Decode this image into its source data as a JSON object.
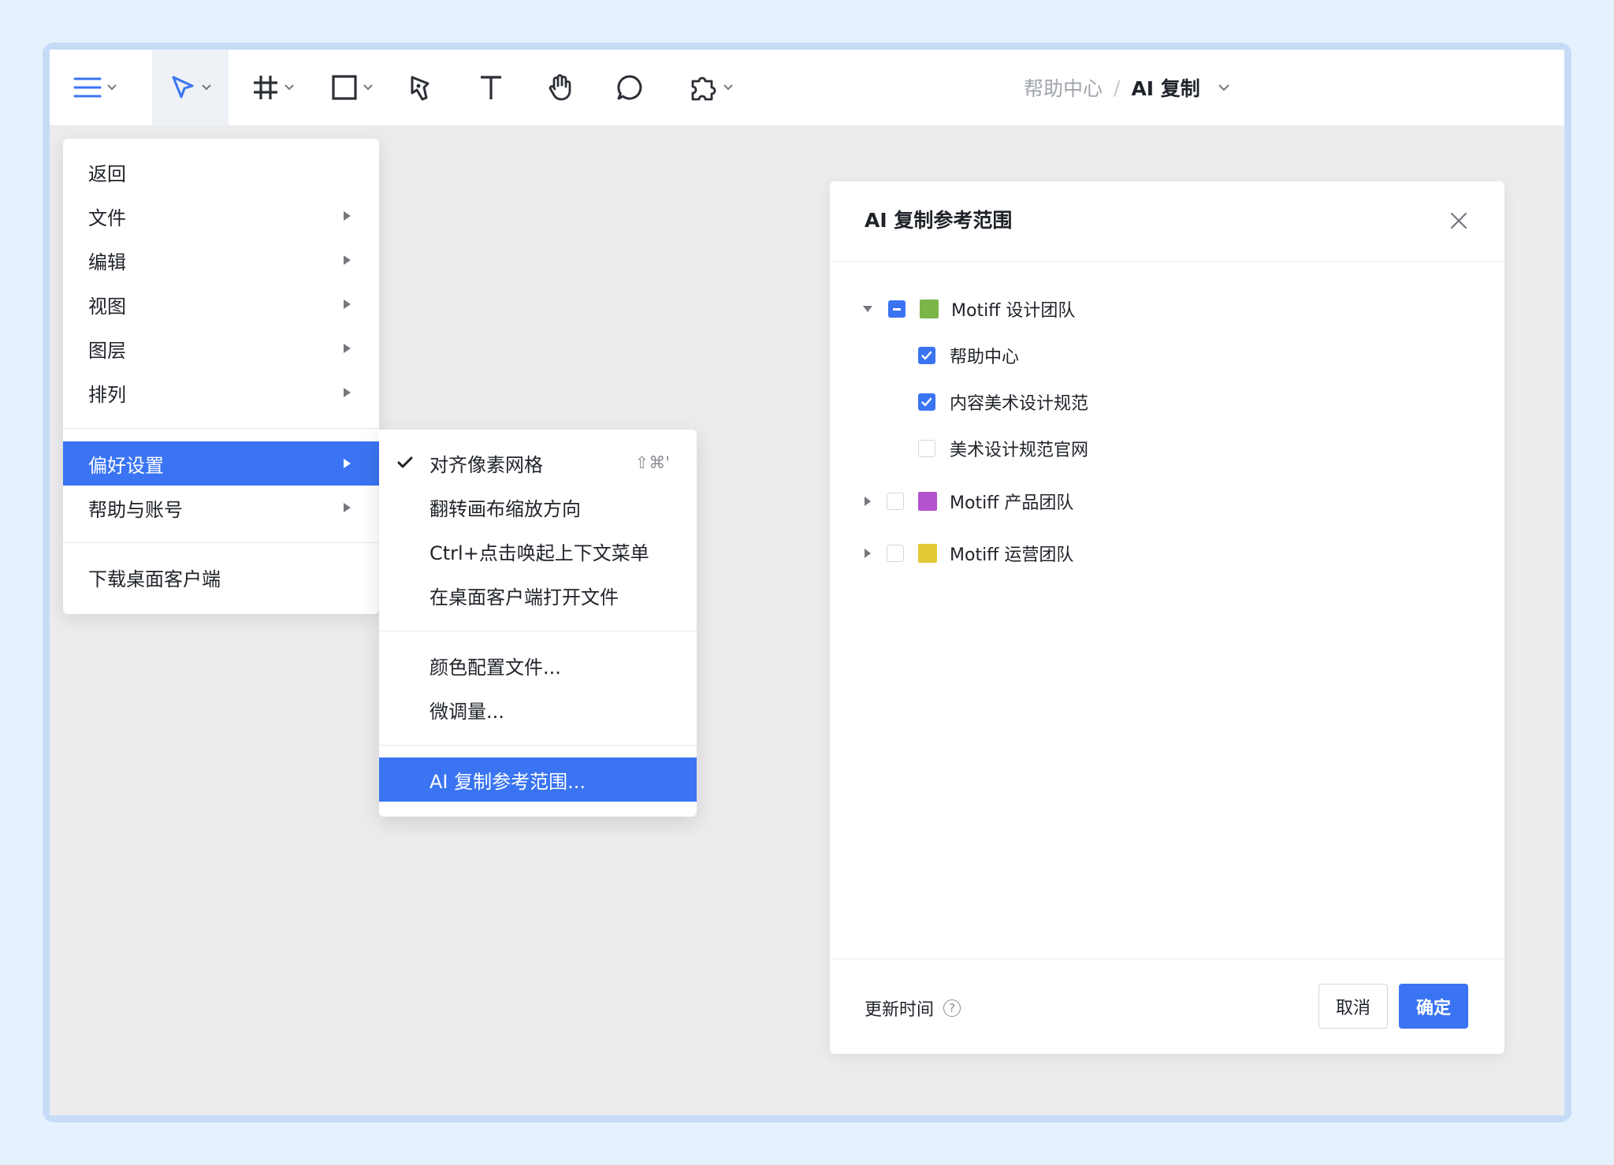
{
  "toolbar": {
    "tools": [
      {
        "icon": "menu-hamburger-icon"
      },
      {
        "icon": "move-pointer-icon"
      },
      {
        "icon": "frame-hash-icon"
      },
      {
        "icon": "rectangle-icon"
      },
      {
        "icon": "pen-icon"
      },
      {
        "icon": "text-icon"
      },
      {
        "icon": "hand-icon"
      },
      {
        "icon": "comment-icon"
      },
      {
        "icon": "plugin-puzzle-icon"
      }
    ],
    "breadcrumb": {
      "parent": "帮助中心",
      "separator": "/",
      "current": "AI 复制"
    }
  },
  "main_menu": {
    "items": [
      {
        "label": "返回"
      },
      {
        "label": "文件"
      },
      {
        "label": "编辑"
      },
      {
        "label": "视图"
      },
      {
        "label": "图层"
      },
      {
        "label": "排列"
      },
      {
        "label": "偏好设置"
      },
      {
        "label": "帮助与账号"
      },
      {
        "label": "下载桌面客户端"
      }
    ]
  },
  "submenu": {
    "items": [
      {
        "label": "对齐像素网格",
        "shortcut": "⇧⌘'"
      },
      {
        "label": "翻转画布缩放方向"
      },
      {
        "label": "Ctrl+点击唤起上下文菜单"
      },
      {
        "label": "在桌面客户端打开文件"
      },
      {
        "label": "颜色配置文件..."
      },
      {
        "label": "微调量..."
      },
      {
        "label": "AI 复制参考范围..."
      }
    ]
  },
  "dialog": {
    "title": "AI 复制参考范围",
    "tree": [
      {
        "label": "Motiff 设计团队",
        "color": "#7ab648"
      },
      {
        "label": "帮助中心"
      },
      {
        "label": "内容美术设计规范"
      },
      {
        "label": "美术设计规范官网"
      },
      {
        "label": "Motiff 产品团队",
        "color": "#b452cd"
      },
      {
        "label": "Motiff 运营团队",
        "color": "#e3c934"
      }
    ],
    "footer_label": "更新时间",
    "help_glyph": "?",
    "cancel_label": "取消",
    "ok_label": "确定"
  },
  "colors": {
    "accent": "#3a74f2"
  }
}
